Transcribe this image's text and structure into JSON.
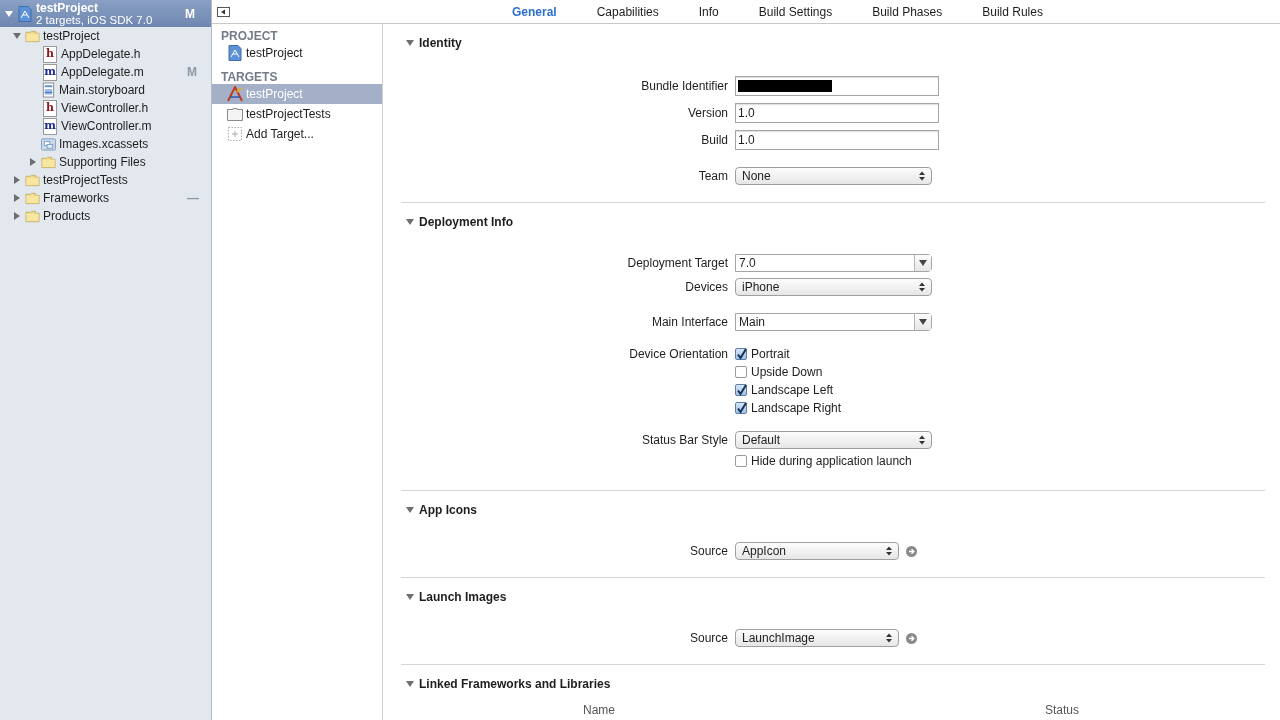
{
  "navigator": {
    "project": {
      "title": "testProject",
      "subtitle": "2 targets, iOS SDK 7.0",
      "status": "M",
      "expanded": true,
      "selected": true,
      "children": [
        {
          "name": "testProject",
          "kind": "folder",
          "expanded": true,
          "children": [
            {
              "name": "AppDelegate.h",
              "kind": "source",
              "letter": "h"
            },
            {
              "name": "AppDelegate.m",
              "kind": "source",
              "letter": "m",
              "status": "M"
            },
            {
              "name": "Main.storyboard",
              "kind": "storyboard"
            },
            {
              "name": "ViewController.h",
              "kind": "source",
              "letter": "h"
            },
            {
              "name": "ViewController.m",
              "kind": "source",
              "letter": "m"
            },
            {
              "name": "Images.xcassets",
              "kind": "assets"
            },
            {
              "name": "Supporting Files",
              "kind": "folder",
              "expanded": false
            }
          ]
        },
        {
          "name": "testProjectTests",
          "kind": "folder",
          "expanded": false
        },
        {
          "name": "Frameworks",
          "kind": "folder",
          "expanded": false,
          "status": "—"
        },
        {
          "name": "Products",
          "kind": "folder",
          "expanded": false
        }
      ]
    }
  },
  "tabs": [
    {
      "label": "General",
      "selected": true
    },
    {
      "label": "Capabilities",
      "selected": false
    },
    {
      "label": "Info",
      "selected": false
    },
    {
      "label": "Build Settings",
      "selected": false
    },
    {
      "label": "Build Phases",
      "selected": false
    },
    {
      "label": "Build Rules",
      "selected": false
    }
  ],
  "targets_list": [
    {
      "heading": "PROJECT",
      "items": [
        {
          "name": "testProject",
          "kind": "project",
          "selected": false
        }
      ]
    },
    {
      "heading": "TARGETS",
      "items": [
        {
          "name": "testProject",
          "kind": "app",
          "selected": true
        },
        {
          "name": "testProjectTests",
          "kind": "bundle",
          "selected": false
        },
        {
          "name": "Add Target...",
          "kind": "add",
          "selected": false
        }
      ]
    }
  ],
  "sections": [
    {
      "title": "Identity",
      "expanded": true,
      "groups": [
        [
          {
            "label": "Bundle Identifier",
            "kind": "redacted"
          },
          {
            "label": "Version",
            "kind": "text",
            "value": "1.0"
          },
          {
            "label": "Build",
            "kind": "text",
            "value": "1.0"
          }
        ],
        [
          {
            "label": "Team",
            "kind": "popup",
            "value": "None"
          }
        ]
      ]
    },
    {
      "title": "Deployment Info",
      "expanded": true,
      "groups": [
        [
          {
            "label": "Deployment Target",
            "kind": "combo",
            "value": "7.0"
          },
          {
            "label": "Devices",
            "kind": "popup",
            "value": "iPhone"
          }
        ],
        [
          {
            "label": "Main Interface",
            "kind": "combo",
            "value": "Main"
          }
        ],
        [
          {
            "label": "Device Orientation",
            "kind": "checkboxes",
            "options": [
              {
                "label": "Portrait",
                "checked": true
              },
              {
                "label": "Upside Down",
                "checked": false
              },
              {
                "label": "Landscape Left",
                "checked": true
              },
              {
                "label": "Landscape Right",
                "checked": true
              }
            ]
          }
        ],
        [
          {
            "label": "Status Bar Style",
            "kind": "popup",
            "value": "Default"
          },
          {
            "kind": "checkboxes",
            "options": [
              {
                "label": "Hide during application launch",
                "checked": false
              }
            ]
          }
        ]
      ]
    },
    {
      "title": "App Icons",
      "expanded": true,
      "groups": [
        [
          {
            "label": "Source",
            "kind": "source",
            "value": "AppIcon"
          }
        ]
      ]
    },
    {
      "title": "Launch Images",
      "expanded": true,
      "groups": [
        [
          {
            "label": "Source",
            "kind": "source",
            "value": "LaunchImage"
          }
        ]
      ]
    },
    {
      "title": "Linked Frameworks and Libraries",
      "expanded": true,
      "table": {
        "columns": [
          "Name",
          "Status"
        ]
      }
    }
  ]
}
